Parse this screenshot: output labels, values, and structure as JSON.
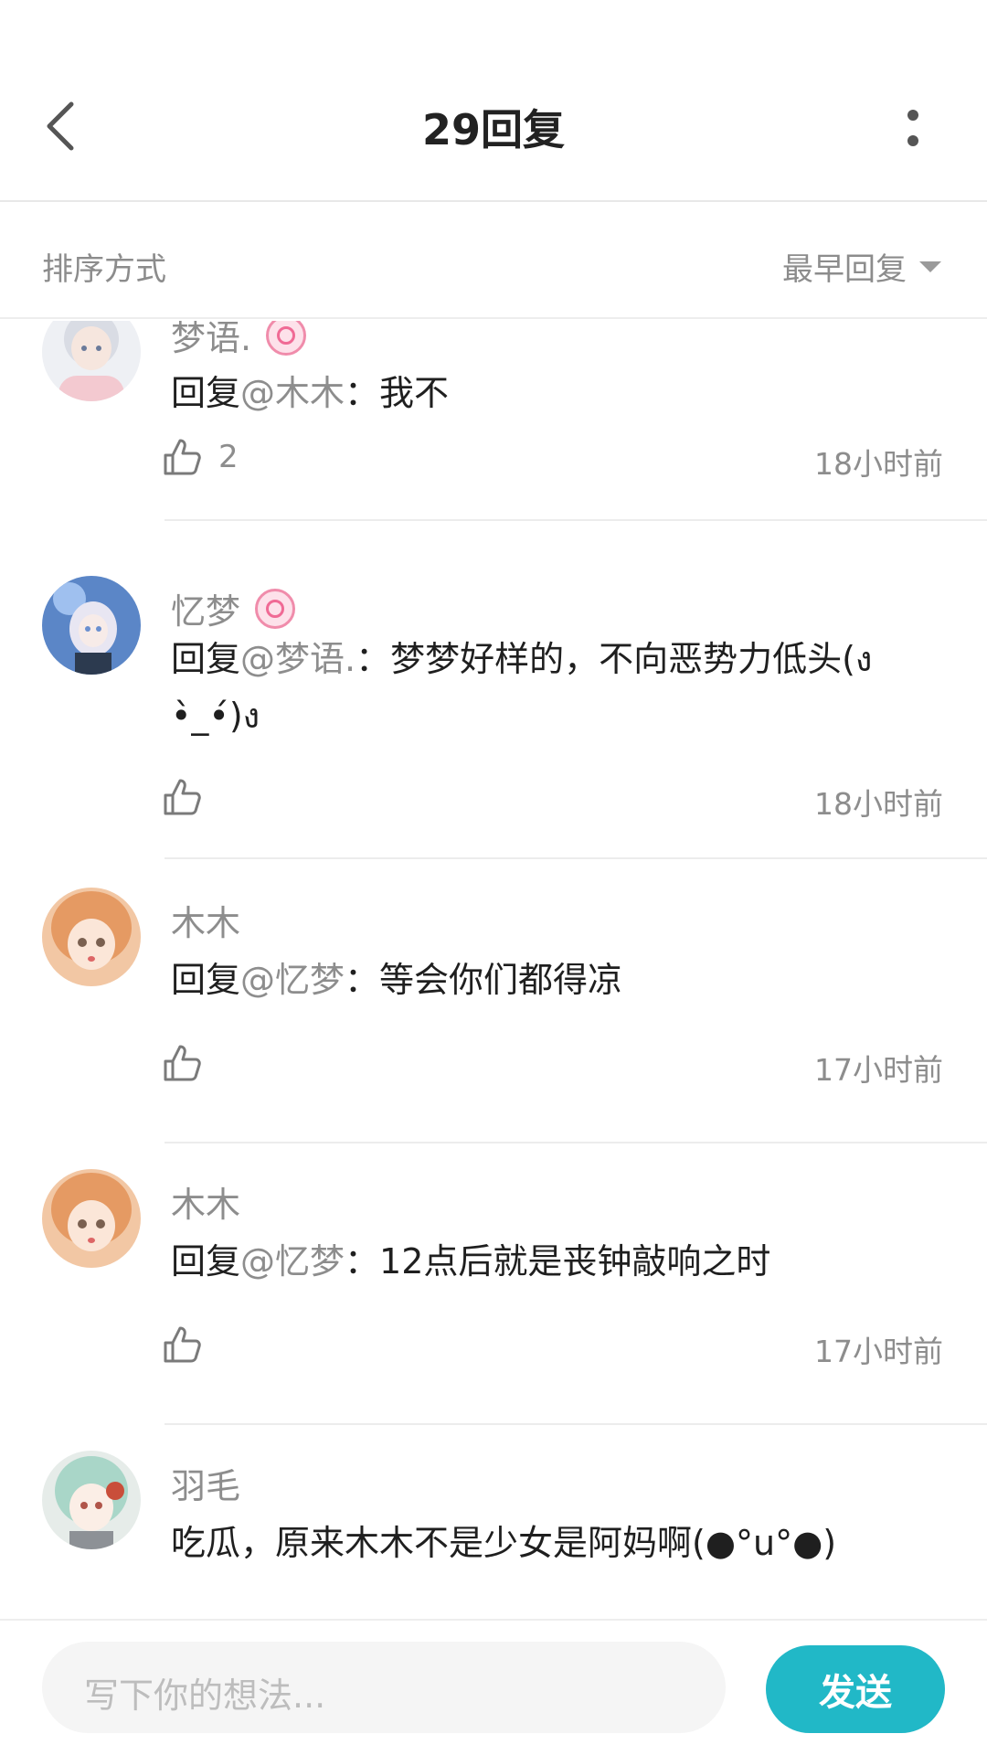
{
  "header": {
    "title": "29回复"
  },
  "sort": {
    "label": "排序方式",
    "selected": "最早回复"
  },
  "comments": [
    {
      "name": "梦语.",
      "reply_prefix": "回复",
      "mention": "@木木",
      "body": "：我不",
      "likes": "2",
      "time": "18小时前"
    },
    {
      "name": "忆梦",
      "reply_prefix": "回复",
      "mention": "@梦语.",
      "body": "：梦梦好样的，不向恶势力低头(ง •̀_•́)ง",
      "likes": "",
      "time": "18小时前"
    },
    {
      "name": "木木",
      "reply_prefix": "回复",
      "mention": "@忆梦",
      "body": "：等会你们都得凉",
      "likes": "",
      "time": "17小时前"
    },
    {
      "name": "木木",
      "reply_prefix": "回复",
      "mention": "@忆梦",
      "body": "：12点后就是丧钟敲响之时",
      "likes": "",
      "time": "17小时前"
    },
    {
      "name": "羽毛",
      "reply_prefix": "",
      "mention": "",
      "body": "吃瓜，原来木木不是少女是阿妈啊(●°u°●)",
      "likes": "",
      "time": ""
    }
  ],
  "composer": {
    "placeholder": "写下你的想法...",
    "send_label": "发送"
  },
  "colors": {
    "accent": "#21b8c7",
    "badge": "#f06a95",
    "muted_text": "#8d8d8d"
  },
  "icons": [
    "back-arrow-icon",
    "more-vertical-icon",
    "caret-down-icon",
    "thumbs-up-icon",
    "level-badge-icon"
  ]
}
